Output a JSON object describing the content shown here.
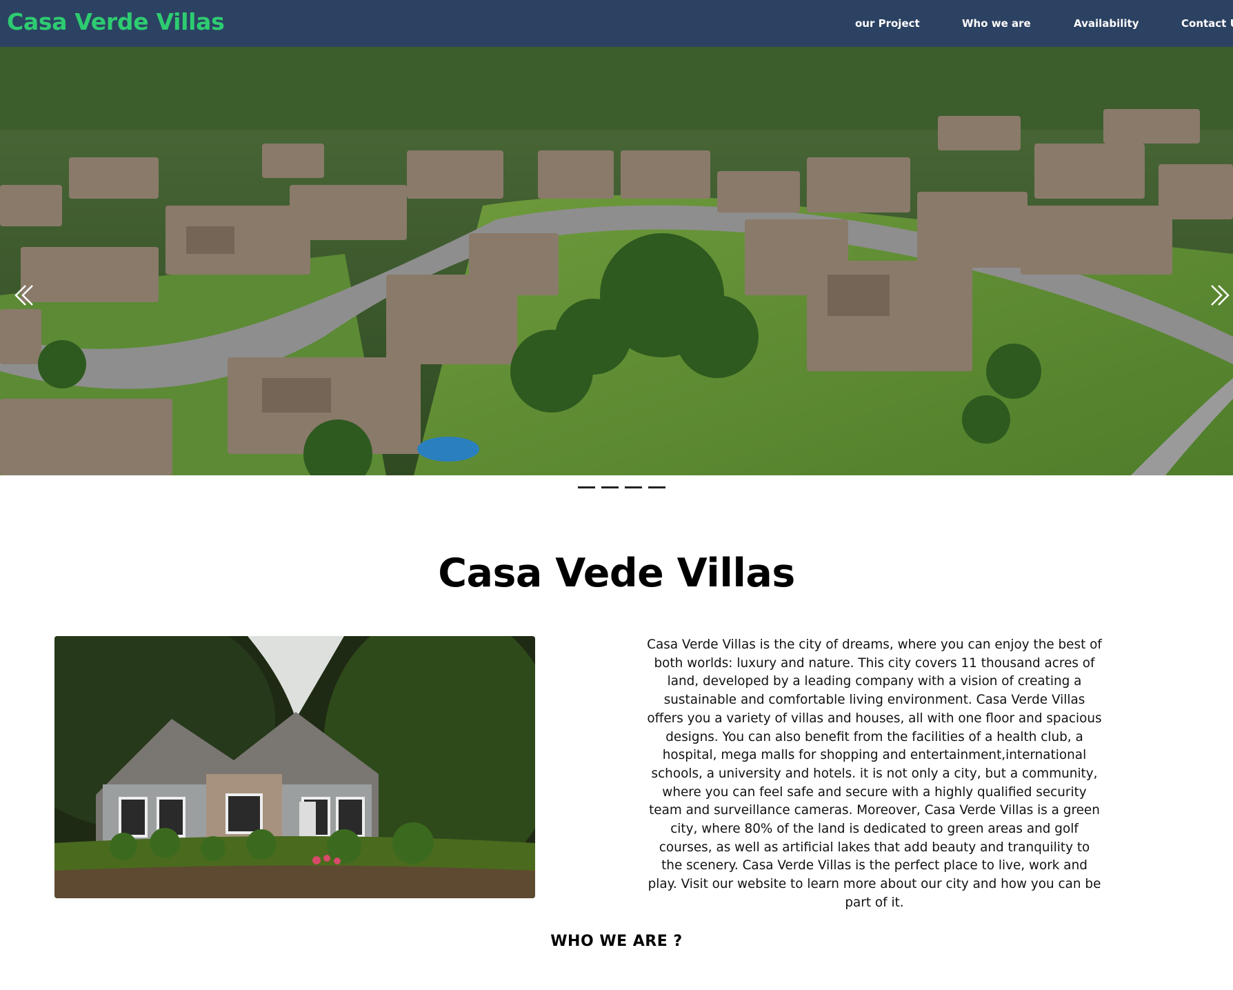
{
  "header": {
    "brand": "Casa Verde Villas",
    "nav": [
      "our Project",
      "Who we are",
      "Availability",
      "Contact Us"
    ]
  },
  "hero": {
    "image": "aerial-neighborhood-photo",
    "slide_count": 4,
    "prev_icon": "double-chevron-left-icon",
    "next_icon": "double-chevron-right-icon"
  },
  "main": {
    "title": "Casa Vede Villas",
    "image": "single-story-house-photo",
    "description": "Casa Verde Villas is the city of dreams, where you can enjoy the best of both worlds: luxury and nature. This city covers 11 thousand acres of land, developed by a leading company with a vision of creating a sustainable and comfortable living environment. Casa Verde Villas offers you a variety of villas and houses, all with one floor and spacious designs. You can also benefit from the facilities of a health club, a hospital, mega malls for shopping and entertainment,international schools, a university and hotels. it is not only a city, but a community, where you can feel safe and secure with a highly qualified security team and surveillance cameras. Moreover, Casa Verde Villas is a green city, where 80% of the land is dedicated to green areas and golf courses, as well as artificial lakes that add beauty and tranquility to the scenery. Casa Verde Villas is the perfect place to live, work and play. Visit our website to learn more about our city and how you can be part of it.",
    "who_heading": "WHO WE ARE ?"
  },
  "colors": {
    "navbar": "#2c4262",
    "brand": "#2ecc71",
    "nav_text": "#ffffff"
  }
}
